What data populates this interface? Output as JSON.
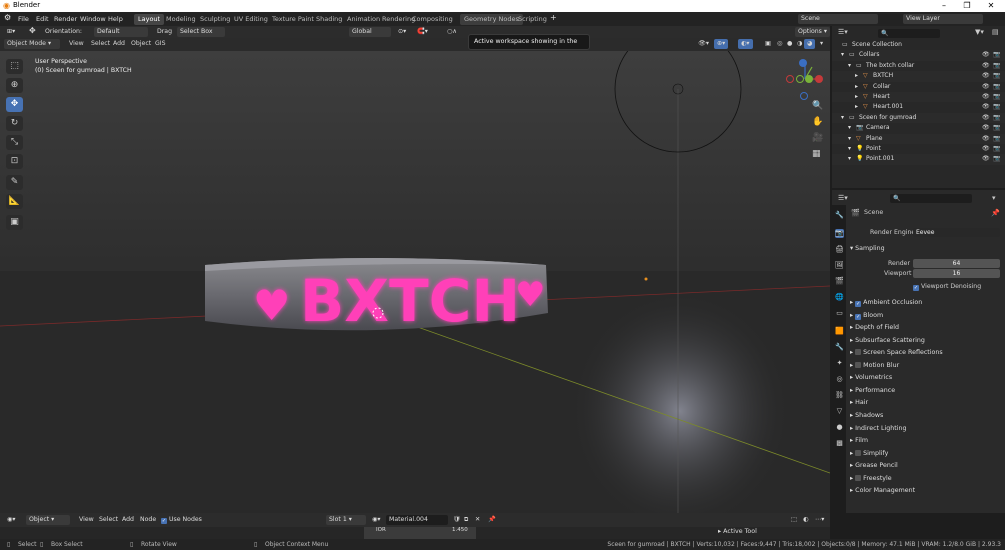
{
  "app": {
    "title": "Blender"
  },
  "menus": [
    "File",
    "Edit",
    "Render",
    "Window",
    "Help"
  ],
  "workspaces": [
    "Layout",
    "Modeling",
    "Sculpting",
    "UV Editing",
    "Texture Paint",
    "Shading",
    "Animation",
    "Rendering",
    "Compositing",
    "Geometry Nodes",
    "Scripting"
  ],
  "top_right": {
    "scene": "Scene",
    "view_layer": "View Layer"
  },
  "header": {
    "orientation_label": "Orientation:",
    "orientation_value": "Default",
    "drag_label": "Drag",
    "drag_value": "Select Box",
    "transform": "Global",
    "options": "Options"
  },
  "header2": {
    "mode": "Object Mode",
    "view": "View",
    "select": "Select",
    "add": "Add",
    "object": "Object",
    "gis": "GIS"
  },
  "tooltip": "Active workspace showing in the window.",
  "viewport": {
    "perspective": "User Perspective",
    "context": "(0) Sceen for gumroad | BXTCH",
    "model_text": "BXTCH",
    "heart_glyph": "♥"
  },
  "outliner": {
    "rows": [
      {
        "label": "Scene Collection",
        "icon": "collection-icon"
      },
      {
        "label": "Collars",
        "icon": "collection-icon"
      },
      {
        "label": "The bxtch collar",
        "icon": "collection-icon"
      },
      {
        "label": "BXTCH",
        "icon": "mesh-icon"
      },
      {
        "label": "Collar",
        "icon": "mesh-icon"
      },
      {
        "label": "Heart",
        "icon": "mesh-icon"
      },
      {
        "label": "Heart.001",
        "icon": "mesh-icon"
      },
      {
        "label": "Sceen for gumroad",
        "icon": "collection-icon"
      },
      {
        "label": "Camera",
        "icon": "camera-icon"
      },
      {
        "label": "Plane",
        "icon": "mesh-icon"
      },
      {
        "label": "Point",
        "icon": "light-icon"
      },
      {
        "label": "Point.001",
        "icon": "light-icon"
      }
    ]
  },
  "properties": {
    "scene": "Scene",
    "render_engine_label": "Render Engine",
    "render_engine_value": "Eevee",
    "sampling": {
      "label": "Sampling",
      "render_label": "Render",
      "render_value": "64",
      "viewport_label": "Viewport",
      "viewport_value": "16",
      "denoise": "Viewport Denoising"
    },
    "sections": [
      {
        "label": "Ambient Occlusion",
        "check": true
      },
      {
        "label": "Bloom",
        "check": true
      },
      {
        "label": "Depth of Field"
      },
      {
        "label": "Subsurface Scattering"
      },
      {
        "label": "Screen Space Reflections",
        "check": false
      },
      {
        "label": "Motion Blur",
        "check": false
      },
      {
        "label": "Volumetrics"
      },
      {
        "label": "Performance"
      },
      {
        "label": "Hair"
      },
      {
        "label": "Shadows"
      },
      {
        "label": "Indirect Lighting"
      },
      {
        "label": "Film"
      },
      {
        "label": "Simplify",
        "check": false
      },
      {
        "label": "Grease Pencil"
      },
      {
        "label": "Freestyle",
        "check": false
      },
      {
        "label": "Color Management"
      }
    ]
  },
  "shader_header": {
    "type": "Object",
    "view": "View",
    "select": "Select",
    "add": "Add",
    "node": "Node",
    "use_nodes": "Use Nodes",
    "slot": "Slot 1",
    "material": "Material.004",
    "ior_label": "IOR",
    "ior_value": "1.450",
    "active_tool": "Active Tool"
  },
  "status": {
    "select": "Select",
    "box_select": "Box Select",
    "rotate": "Rotate View",
    "context_menu": "Object Context Menu",
    "stats": "Sceen for gumroad | BXTCH | Verts:10,032 | Faces:9,447 | Tris:18,002 | Objects:0/8 | Memory: 47.1 MiB | VRAM: 1.2/8.0 GiB | 2.93.3"
  },
  "colors": {
    "accent": "#4772b3",
    "neon": "#ff3fb8",
    "bg": "#1d1d1d"
  }
}
